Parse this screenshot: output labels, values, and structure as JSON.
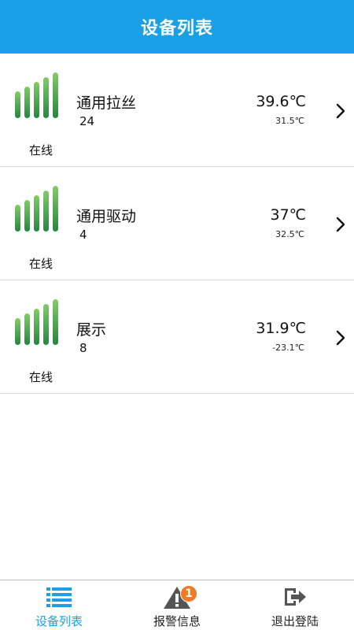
{
  "header": {
    "title": "设备列表"
  },
  "devices": [
    {
      "name": "通用拉丝",
      "count": "24",
      "status": "在线",
      "temp_main": "39.6℃",
      "temp_sub": "31.5℃",
      "signal_icon": "signal-strength-icon"
    },
    {
      "name": "通用驱动",
      "count": "4",
      "status": "在线",
      "temp_main": "37℃",
      "temp_sub": "32.5℃",
      "signal_icon": "signal-strength-icon"
    },
    {
      "name": "展示",
      "count": "8",
      "status": "在线",
      "temp_main": "31.9℃",
      "temp_sub": "-23.1℃",
      "signal_icon": "signal-strength-icon"
    }
  ],
  "nav": {
    "items": [
      {
        "label": "设备列表",
        "icon": "list-icon",
        "active": true
      },
      {
        "label": "报警信息",
        "icon": "warning-icon",
        "badge": "1"
      },
      {
        "label": "退出登陆",
        "icon": "logout-icon"
      }
    ]
  },
  "colors": {
    "accent": "#1aa0e6",
    "signal_green": "#3aa34a",
    "badge": "#f07a24"
  }
}
